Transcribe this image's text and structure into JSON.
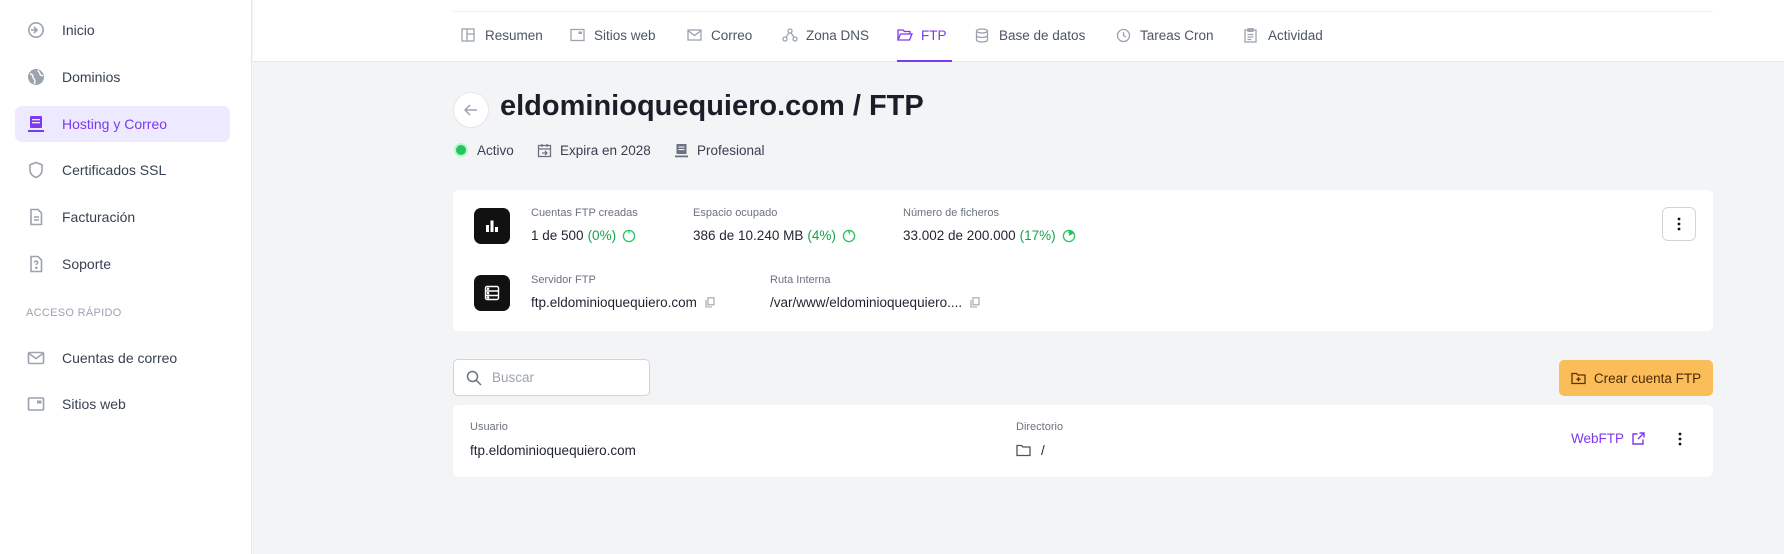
{
  "sidebar": {
    "items": [
      {
        "label": "Inicio",
        "icon": "home-icon"
      },
      {
        "label": "Dominios",
        "icon": "globe-icon"
      },
      {
        "label": "Hosting y Correo",
        "icon": "server-icon"
      },
      {
        "label": "Certificados SSL",
        "icon": "shield-icon"
      },
      {
        "label": "Facturación",
        "icon": "invoice-icon"
      },
      {
        "label": "Soporte",
        "icon": "help-icon"
      }
    ],
    "quick_access_label": "ACCESO RÁPIDO",
    "quick_items": [
      {
        "label": "Cuentas de correo",
        "icon": "mail-icon"
      },
      {
        "label": "Sitios web",
        "icon": "browser-icon"
      }
    ]
  },
  "tabs": [
    {
      "label": "Resumen"
    },
    {
      "label": "Sitios web"
    },
    {
      "label": "Correo"
    },
    {
      "label": "Zona DNS"
    },
    {
      "label": "FTP"
    },
    {
      "label": "Base de datos"
    },
    {
      "label": "Tareas Cron"
    },
    {
      "label": "Actividad"
    }
  ],
  "header": {
    "title": "eldominioquequiero.com / FTP",
    "status": "Activo",
    "expiry": "Expira en 2028",
    "plan": "Profesional"
  },
  "stats": {
    "accounts": {
      "label": "Cuentas FTP creadas",
      "value": "1 de 500",
      "pct": "(0%)",
      "fraction": 0
    },
    "space": {
      "label": "Espacio ocupado",
      "value": "386 de 10.240 MB",
      "pct": "(4%)",
      "fraction": 0.04
    },
    "files": {
      "label": "Número de ficheros",
      "value": "33.002 de 200.000",
      "pct": "(17%)",
      "fraction": 0.17
    },
    "server": {
      "label": "Servidor FTP",
      "value": "ftp.eldominioquequiero.com"
    },
    "path": {
      "label": "Ruta Interna",
      "value": "/var/www/eldominioquequiero...."
    }
  },
  "search": {
    "placeholder": "Buscar"
  },
  "create_label": "Crear cuenta FTP",
  "table": {
    "col_user": "Usuario",
    "col_dir": "Directorio",
    "rows": [
      {
        "user": "ftp.eldominioquequiero.com",
        "dir": "/",
        "action": "WebFTP"
      }
    ]
  },
  "colors": {
    "accent": "#7c3aed",
    "success": "#22c55e",
    "warning": "#fbbd5a"
  }
}
